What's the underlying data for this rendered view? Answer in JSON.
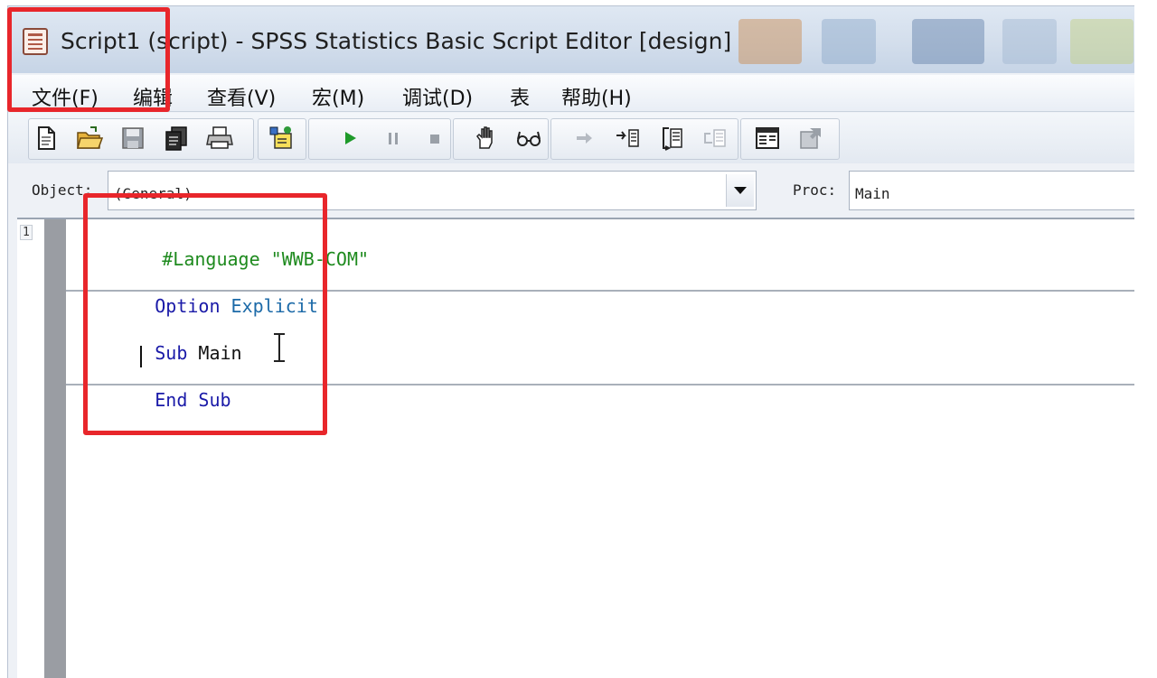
{
  "window": {
    "title": "Script1 (script) - SPSS Statistics Basic Script Editor [design]"
  },
  "menu": {
    "items": [
      {
        "label": "文件(F)"
      },
      {
        "label": "编辑"
      },
      {
        "label": "查看(V)"
      },
      {
        "label": "宏(M)"
      },
      {
        "label": "调试(D)"
      },
      {
        "label": "表"
      },
      {
        "label": "帮助(H)"
      }
    ]
  },
  "toolbar": {
    "buttons": [
      "new-icon",
      "open-folder-icon",
      "save-icon",
      "copy-icon",
      "print-icon",
      "dialog-editor-icon",
      "run-icon",
      "pause-icon",
      "stop-icon",
      "toggle-breakpoint-icon",
      "quick-watch-icon",
      "step-into-icon",
      "step-over-icon",
      "step-out-icon",
      "step-back-icon",
      "object-browser-icon",
      "properties-icon"
    ]
  },
  "object_bar": {
    "object_label": "Object:",
    "object_value": "(General)",
    "proc_label": "Proc:",
    "proc_value": "Main"
  },
  "editor": {
    "line_number": "1",
    "lines": {
      "language_directive": "#Language",
      "language_value": "\"WWB-COM\"",
      "option_kw": "Option",
      "explicit_kw": "Explicit",
      "sub_kw": "Sub",
      "main_ident": "Main",
      "end_kw": "End",
      "end_sub_kw": "Sub"
    }
  },
  "colors": {
    "highlight": "#e8262b",
    "keyword": "#1a1aa8",
    "directive": "#1e8a1e"
  }
}
